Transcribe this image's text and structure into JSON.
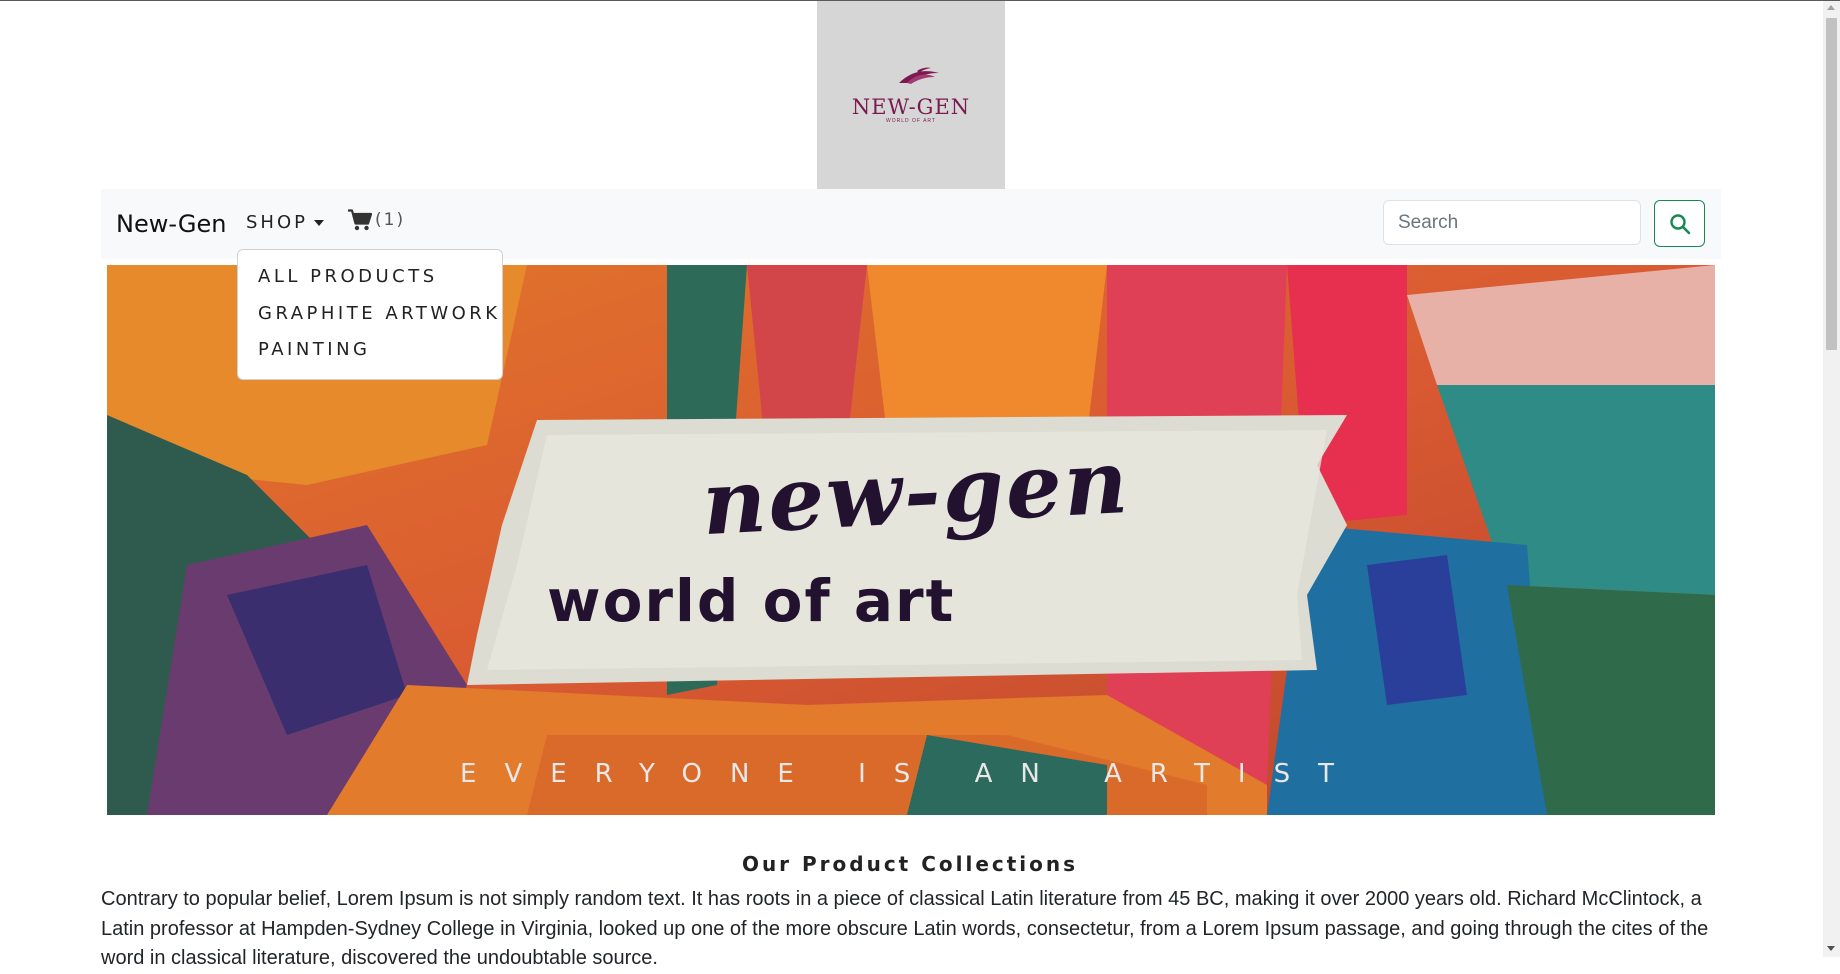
{
  "logo": {
    "text": "NEW-GEN",
    "subtext": "WORLD OF ART"
  },
  "navbar": {
    "brand": "New-Gen",
    "shop_label": "SHOP",
    "cart_count": "(1)",
    "search_placeholder": "Search"
  },
  "dropdown": {
    "items": [
      "ALL PRODUCTS",
      "GRAPHITE ARTWORK",
      "PAINTING"
    ]
  },
  "hero": {
    "script_text": "new-gen",
    "subtitle": "world of art",
    "tagline": "EVERYONE IS AN ARTIST"
  },
  "section": {
    "title": "Our Product Collections",
    "paragraph": "Contrary to popular belief, Lorem Ipsum is not simply random text. It has roots in a piece of classical Latin literature from 45 BC, making it over 2000 years old. Richard McClintock, a Latin professor at Hampden-Sydney College in Virginia, looked up one of the more obscure Latin words, consectetur, from a Lorem Ipsum passage, and going through the cites of the word in classical literature, discovered the undoubtable source."
  },
  "colors": {
    "accent": "#198754",
    "logo": "#7a1a4f",
    "navbar_bg": "#f8f9fa"
  },
  "icons": {
    "cart": "cart-icon",
    "search": "search-icon"
  }
}
